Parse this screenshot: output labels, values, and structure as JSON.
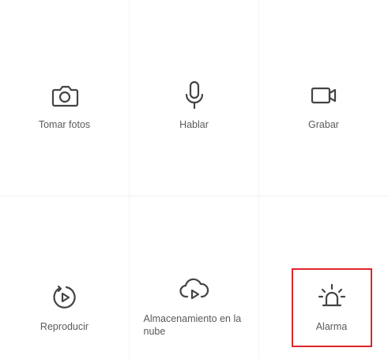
{
  "actions": [
    {
      "label": "Tomar fotos",
      "icon": "camera-icon"
    },
    {
      "label": "Hablar",
      "icon": "microphone-icon"
    },
    {
      "label": "Grabar",
      "icon": "video-camera-icon"
    },
    {
      "label": "Reproducir",
      "icon": "playback-icon"
    },
    {
      "label": "Almacenamiento en la nube",
      "icon": "cloud-play-icon"
    },
    {
      "label": "Alarma",
      "icon": "siren-icon"
    }
  ],
  "highlight": {
    "target": "Alarma",
    "color": "#e0252c"
  }
}
